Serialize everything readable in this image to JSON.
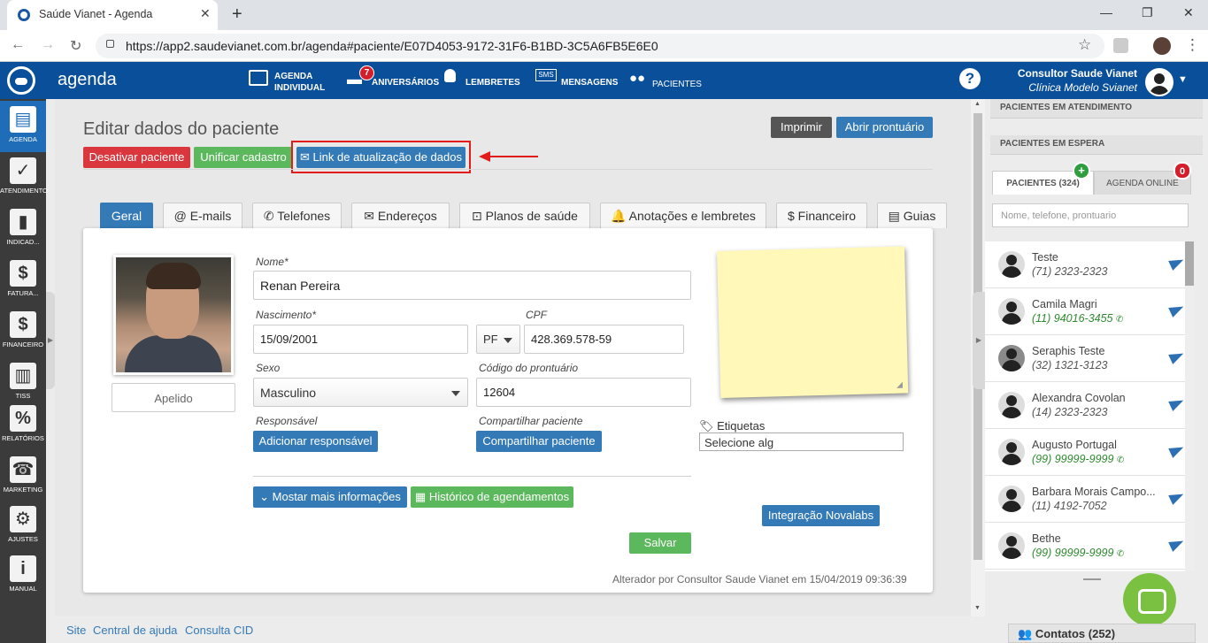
{
  "browser": {
    "tab_title": "Saúde Vianet - Agenda",
    "tab_close": "✕",
    "new_tab": "+",
    "url": "https://app2.saudevianet.com.br/agenda#paciente/E07D4053-9172-31F6-B1BD-3C5A6FB5E6E0",
    "back": "←",
    "forward": "→",
    "reload": "↻",
    "star": "☆",
    "minimize": "—",
    "restore": "❐",
    "close": "✕",
    "menu": "⋮"
  },
  "topbar": {
    "app_name": "agenda",
    "menu": [
      {
        "icon": "calendar-icon",
        "label1": "AGENDA",
        "label2": "INDIVIDUAL"
      },
      {
        "icon": "cake-icon",
        "label1": "ANIVERSÁRIOS",
        "badge": "7"
      },
      {
        "icon": "lightbulb-icon",
        "label1": "LEMBRETES"
      },
      {
        "icon": "sms-icon",
        "label1": "MENSAGENS",
        "icon_text": "SMS"
      },
      {
        "icon": "users-icon",
        "label1": "PACIENTES"
      }
    ],
    "help": "?",
    "user_name": "Consultor Saude Vianet",
    "user_clinic": "Clínica Modelo Svianet"
  },
  "sidebar": [
    {
      "label": "AGENDA",
      "icon": "agenda-icon"
    },
    {
      "label": "ATENDIMENTO",
      "icon": "folder-check-icon"
    },
    {
      "label": "INDICAD...",
      "icon": "bar-chart-icon"
    },
    {
      "label": "FATURA...",
      "icon": "dollar-doc-icon",
      "glyph": "$"
    },
    {
      "label": "FINANCEIRO",
      "icon": "dollar-icon",
      "glyph": "$"
    },
    {
      "label": "TISS",
      "icon": "tiss-icon"
    },
    {
      "label": "RELATÓRIOS",
      "icon": "percent-icon",
      "glyph": "%"
    },
    {
      "label": "MARKETING",
      "icon": "phone-icon"
    },
    {
      "label": "AJUSTES",
      "icon": "gears-icon",
      "glyph": "⚙"
    },
    {
      "label": "MANUAL",
      "icon": "manual-icon",
      "glyph": "i"
    }
  ],
  "page": {
    "title": "Editar dados do paciente",
    "btn_print": "Imprimir",
    "btn_record": "Abrir prontuário",
    "btn_deactivate": "Desativar paciente",
    "btn_merge": "Unificar cadastro",
    "btn_link": "Link de atualização de dados",
    "tabs": [
      {
        "label": "Geral",
        "icon": ""
      },
      {
        "label": "E-mails",
        "icon": "@"
      },
      {
        "label": "Telefones",
        "icon": "✆"
      },
      {
        "label": "Endereços",
        "icon": "✉"
      },
      {
        "label": "Planos de saúde",
        "icon": "⊡"
      },
      {
        "label": "Anotações e lembretes",
        "icon": "🔔"
      },
      {
        "label": "Financeiro",
        "icon": "$"
      },
      {
        "label": "Guias",
        "icon": "▤"
      }
    ]
  },
  "form": {
    "apelido_placeholder": "Apelido",
    "nome_label": "Nome*",
    "nome_value": "Renan Pereira",
    "nascimento_label": "Nascimento*",
    "nascimento_value": "15/09/2001",
    "cpf_label": "CPF",
    "cpf_type": "PF",
    "cpf_value": "428.369.578-59",
    "sexo_label": "Sexo",
    "sexo_value": "Masculino",
    "codigo_label": "Código do prontuário",
    "codigo_value": "12604",
    "responsavel_label": "Responsável",
    "responsavel_btn": "Adicionar responsável",
    "compartilhar_label": "Compartilhar paciente",
    "compartilhar_btn": "Compartilhar paciente",
    "mais_info_btn": "Mostar mais informações",
    "historico_btn": "Histórico de agendamentos",
    "etiquetas_label": "Etiquetas",
    "etiquetas_placeholder": "Selecione alg",
    "integracao_btn": "Integração Novalabs",
    "salvar_btn": "Salvar",
    "altered_text": "Alterador por Consultor Saude Vianet em 15/04/2019 09:36:39"
  },
  "footer": {
    "links": [
      "Site",
      "Central de ajuda",
      "Consulta CID"
    ]
  },
  "right_panel": {
    "em_atendimento": "PACIENTES EM ATENDIMENTO",
    "em_espera": "PACIENTES EM ESPERA",
    "tab_pacientes": "PACIENTES (324)",
    "tab_agenda_online": "AGENDA ONLINE",
    "agenda_online_badge": "0",
    "search_placeholder": "Nome, telefone, prontuario",
    "patients": [
      {
        "name": "Teste",
        "phone": "(71) 2323-2323",
        "whatsapp": false,
        "photo": false
      },
      {
        "name": "Camila Magri",
        "phone": "(11) 94016-3455",
        "whatsapp": true,
        "photo": false
      },
      {
        "name": "Seraphis Teste",
        "phone": "(32) 1321-3123",
        "whatsapp": false,
        "photo": true
      },
      {
        "name": "Alexandra Covolan",
        "phone": "(14) 2323-2323",
        "whatsapp": false,
        "photo": false
      },
      {
        "name": "Augusto Portugal",
        "phone": "(99) 99999-9999",
        "whatsapp": true,
        "photo": false
      },
      {
        "name": "Barbara Morais Campo...",
        "phone": "(11) 4192-7052",
        "whatsapp": false,
        "photo": false
      },
      {
        "name": "Bethe",
        "phone": "(99) 99999-9999",
        "whatsapp": true,
        "photo": false
      }
    ],
    "contatos": "Contatos (252)"
  },
  "colors": {
    "brand_blue": "#0a4f9a",
    "btn_blue": "#337ab7",
    "btn_red": "#d9363e",
    "btn_green": "#5cb85c",
    "highlight_red": "#e21b1b",
    "note_yellow": "#fff8b8"
  }
}
